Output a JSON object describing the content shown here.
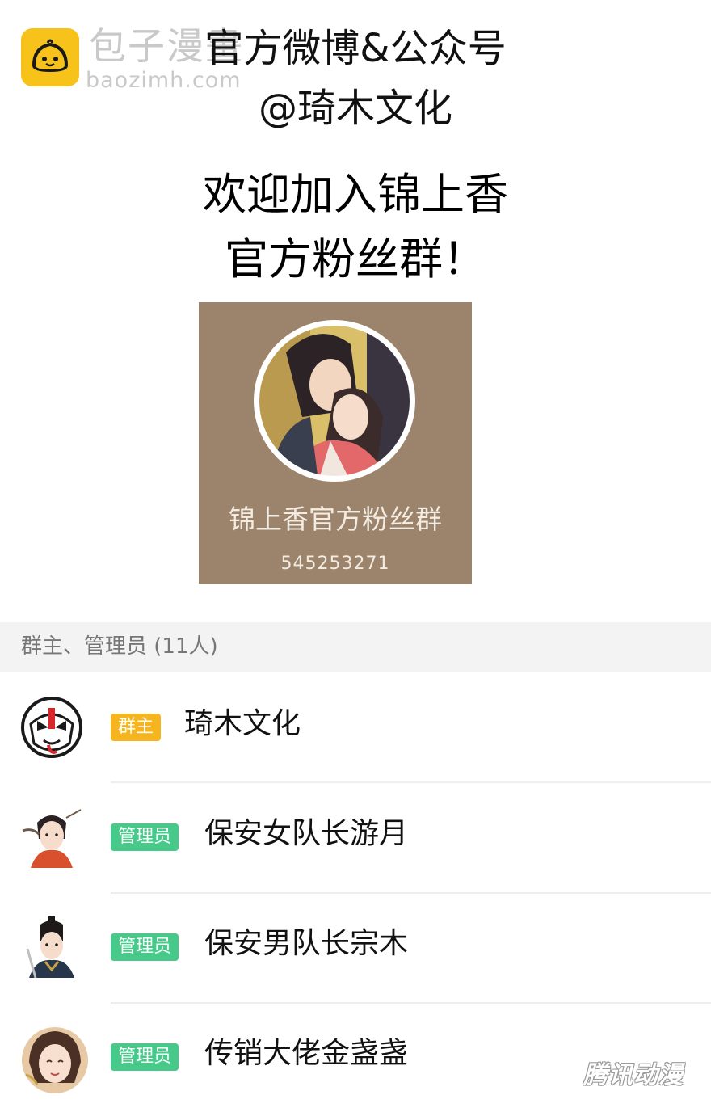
{
  "watermark": {
    "brand": "包子漫畫",
    "domain": "baozimh.com",
    "corner": "腾讯动漫",
    "logo_color": "#f7c21a"
  },
  "header": {
    "line1": "官方微博&公众号",
    "line2": "@琦木文化"
  },
  "welcome": {
    "line1": "欢迎加入锦上香",
    "line2": "官方粉丝群！"
  },
  "group_card": {
    "name": "锦上香官方粉丝群",
    "id": "545253271",
    "background": "#9c836b",
    "avatar_icon": "couple-illustration-icon"
  },
  "admins_section": {
    "label": "群主、管理员 (11人)"
  },
  "members": [
    {
      "role": "群主",
      "role_type": "owner",
      "name": "琦木文化",
      "avatar_icon": "opera-mask-avatar-icon"
    },
    {
      "role": "管理员",
      "role_type": "admin",
      "name": "保安女队长游月",
      "avatar_icon": "female-guard-avatar-icon"
    },
    {
      "role": "管理员",
      "role_type": "admin",
      "name": "保安男队长宗木",
      "avatar_icon": "male-guard-avatar-icon"
    },
    {
      "role": "管理员",
      "role_type": "admin",
      "name": "传销大佬金盏盏",
      "avatar_icon": "lady-avatar-icon"
    }
  ],
  "colors": {
    "owner_badge": "#f6b51e",
    "admin_badge": "#47c98a"
  }
}
